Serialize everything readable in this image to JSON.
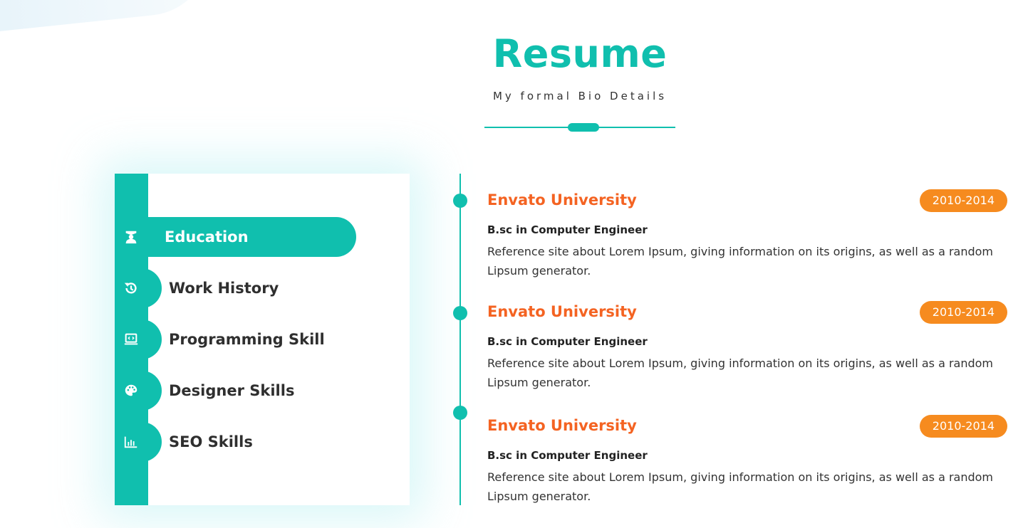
{
  "header": {
    "title": "Resume",
    "subtitle": "My formal Bio Details"
  },
  "colors": {
    "accent": "#10bfae",
    "entry_title": "#f46322",
    "badge": "#f68b1f"
  },
  "tabs": [
    {
      "label": "Education",
      "icon": "graduate-icon",
      "active": true
    },
    {
      "label": "Work History",
      "icon": "history-icon",
      "active": false
    },
    {
      "label": "Programming Skill",
      "icon": "laptop-code-icon",
      "active": false
    },
    {
      "label": "Designer Skills",
      "icon": "palette-icon",
      "active": false
    },
    {
      "label": "SEO Skills",
      "icon": "bar-chart-icon",
      "active": false
    }
  ],
  "entries": [
    {
      "title": "Envato University",
      "years": "2010-2014",
      "degree": "B.sc in Computer Engineer",
      "description": "Reference site about Lorem Ipsum, giving information on its origins, as well as a random Lipsum generator."
    },
    {
      "title": "Envato University",
      "years": "2010-2014",
      "degree": "B.sc in Computer Engineer",
      "description": "Reference site about Lorem Ipsum, giving information on its origins, as well as a random Lipsum generator."
    },
    {
      "title": "Envato University",
      "years": "2010-2014",
      "degree": "B.sc in Computer Engineer",
      "description": "Reference site about Lorem Ipsum, giving information on its origins, as well as a random Lipsum generator."
    }
  ]
}
